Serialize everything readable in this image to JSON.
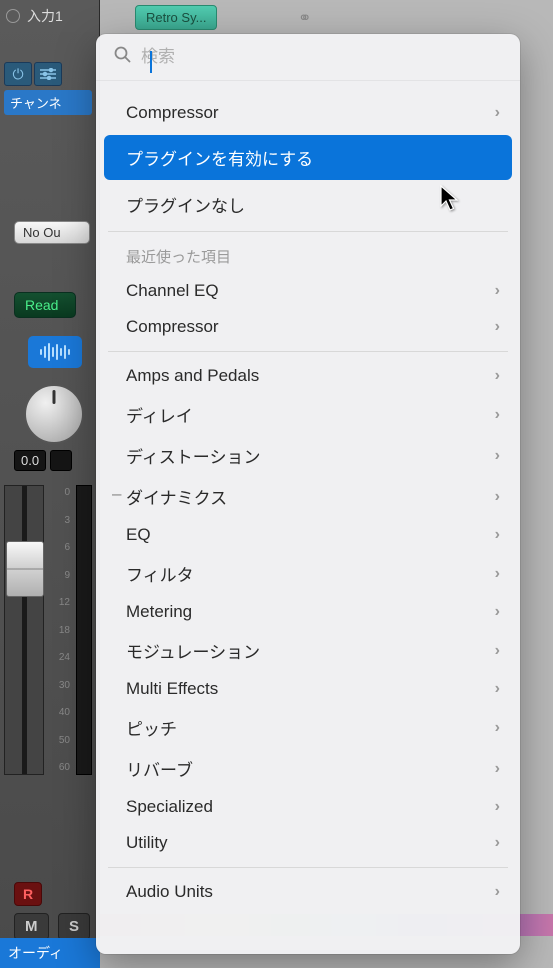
{
  "top": {
    "input_label": "入力1",
    "synth_label": "Retro Sy...",
    "stereo_glyph": "⚭"
  },
  "strip": {
    "channel_label": "チャンネ",
    "no_output": "No Ou",
    "read": "Read",
    "db_value": "0.0",
    "scale": [
      "0",
      "3",
      "6",
      "9",
      "12",
      "18",
      "24",
      "30",
      "40",
      "50",
      "60"
    ],
    "rec": "R",
    "mute": "M",
    "solo": "S",
    "track_name": "オーディ"
  },
  "popup": {
    "search_placeholder": "検索",
    "top_items": [
      {
        "label": "Compressor",
        "has_submenu": true
      }
    ],
    "highlighted": {
      "label": "プラグインを有効にする",
      "has_submenu": false
    },
    "no_plugin": {
      "label": "プラグインなし",
      "has_submenu": false
    },
    "recent_header": "最近使った項目",
    "recent_items": [
      {
        "label": "Channel EQ",
        "has_submenu": true
      },
      {
        "label": "Compressor",
        "has_submenu": true
      }
    ],
    "category_items": [
      {
        "label": "Amps and Pedals",
        "has_submenu": true,
        "dash": false
      },
      {
        "label": "ディレイ",
        "has_submenu": true,
        "dash": false
      },
      {
        "label": "ディストーション",
        "has_submenu": true,
        "dash": false
      },
      {
        "label": "ダイナミクス",
        "has_submenu": true,
        "dash": true
      },
      {
        "label": "EQ",
        "has_submenu": true,
        "dash": false
      },
      {
        "label": "フィルタ",
        "has_submenu": true,
        "dash": false
      },
      {
        "label": "Metering",
        "has_submenu": true,
        "dash": false
      },
      {
        "label": "モジュレーション",
        "has_submenu": true,
        "dash": false
      },
      {
        "label": "Multi Effects",
        "has_submenu": true,
        "dash": false
      },
      {
        "label": "ピッチ",
        "has_submenu": true,
        "dash": false
      },
      {
        "label": "リバーブ",
        "has_submenu": true,
        "dash": false
      },
      {
        "label": "Specialized",
        "has_submenu": true,
        "dash": false
      },
      {
        "label": "Utility",
        "has_submenu": true,
        "dash": false
      }
    ],
    "bottom_items": [
      {
        "label": "Audio Units",
        "has_submenu": true
      }
    ]
  }
}
